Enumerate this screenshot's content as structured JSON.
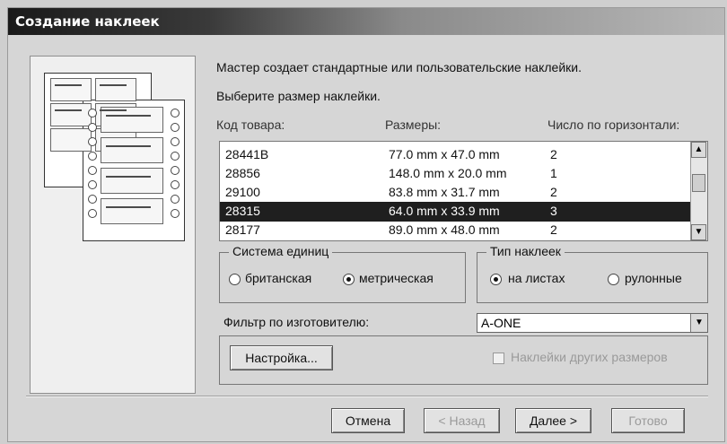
{
  "window": {
    "title": "Создание наклеек"
  },
  "intro": {
    "line1": "Мастер создает стандартные или пользовательские наклейки.",
    "line2": "Выберите размер наклейки."
  },
  "table": {
    "headers": {
      "code": "Код товара:",
      "size": "Размеры:",
      "count": "Число по горизонтали:"
    },
    "rows": [
      {
        "code": "28441B",
        "size": "77.0 mm x 47.0 mm",
        "count": "2"
      },
      {
        "code": "28856",
        "size": "148.0 mm x 20.0 mm",
        "count": "1"
      },
      {
        "code": "29100",
        "size": "83.8 mm x 31.7 mm",
        "count": "2"
      },
      {
        "code": "28315",
        "size": "64.0 mm x 33.9 mm",
        "count": "3",
        "selected": true
      },
      {
        "code": "28177",
        "size": "89.0 mm x 48.0 mm",
        "count": "2"
      }
    ]
  },
  "units": {
    "legend": "Система единиц",
    "british": "британская",
    "metric": "метрическая",
    "selected": "metric"
  },
  "labels": {
    "legend": "Тип наклеек",
    "sheets": "на листах",
    "rolls": "рулонные",
    "selected": "sheets"
  },
  "filter": {
    "label": "Фильтр по изготовителю:",
    "value": "A-ONE"
  },
  "buttons": {
    "settings": "Настройка...",
    "cancel": "Отмена",
    "back": "< Назад",
    "next": "Далее >",
    "finish": "Готово"
  },
  "checkbox": {
    "label": "Наклейки других размеров",
    "checked": false,
    "enabled": false
  },
  "icons": {
    "scroll_up": "scroll-up-icon",
    "scroll_down": "scroll-down-icon",
    "dropdown": "chevron-down-icon",
    "illustration": "label-sheet-illustration"
  }
}
